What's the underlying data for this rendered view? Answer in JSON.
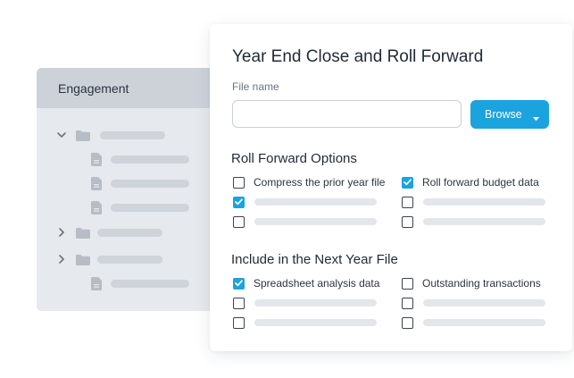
{
  "engagement": {
    "title": "Engagement"
  },
  "dialog": {
    "title": "Year End Close and Roll Forward",
    "file_name_label": "File name",
    "file_name_value": "",
    "browse_label": "Browse",
    "roll_forward": {
      "title": "Roll Forward Options",
      "options": [
        {
          "label": "Compress the prior year file",
          "checked": false
        },
        {
          "label": "Roll forward budget data",
          "checked": true
        },
        {
          "label": "",
          "checked": true
        },
        {
          "label": "",
          "checked": false
        },
        {
          "label": "",
          "checked": false
        },
        {
          "label": "",
          "checked": false
        }
      ]
    },
    "next_year": {
      "title": "Include in the Next Year File",
      "options": [
        {
          "label": "Spreadsheet analysis data",
          "checked": true
        },
        {
          "label": "Outstanding transactions",
          "checked": false
        },
        {
          "label": "",
          "checked": false
        },
        {
          "label": "",
          "checked": false
        },
        {
          "label": "",
          "checked": false
        },
        {
          "label": "",
          "checked": false
        }
      ]
    }
  },
  "colors": {
    "accent": "#1aa3df",
    "panel_bg": "#e6e9ed",
    "panel_header": "#cdd2d9",
    "placeholder": "#cfd4db"
  }
}
